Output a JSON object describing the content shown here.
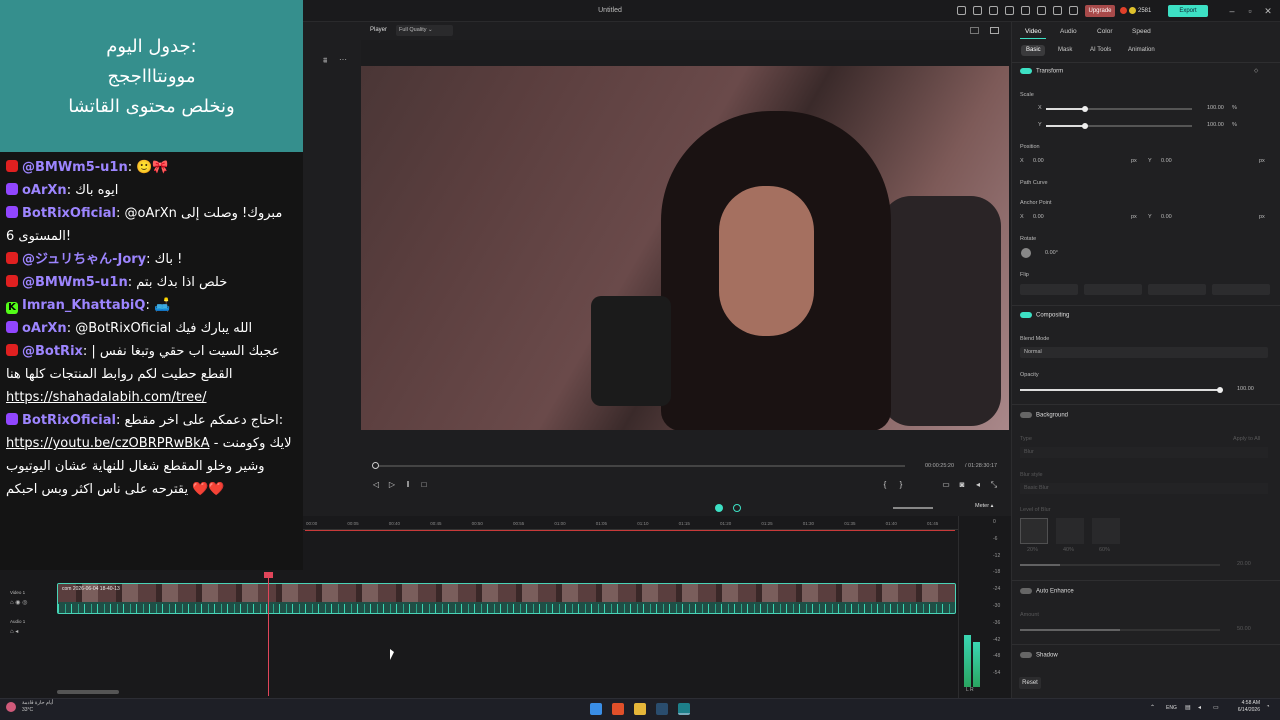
{
  "app": {
    "title": "Untitled",
    "upgrade_label": "Upgrade",
    "credits": "2581",
    "export_label": "Export"
  },
  "overlay": {
    "banner_lines": [
      ":جدول اليوم",
      "موونتاااججج",
      "ونخلص محتوى القاتشا"
    ],
    "chat": [
      {
        "platform": "youtube",
        "user": "@BMWm5-u1n",
        "text": ": 🙂🎀"
      },
      {
        "platform": "twitch",
        "user": "oArXn",
        "text": ": ايوه باك"
      },
      {
        "platform": "twitch",
        "user": "BotRixOficial",
        "text": ": @oArXn مبروك! وصلت إلى المستوى 6!"
      },
      {
        "platform": "youtube",
        "user": "@ジュリちゃん-Jory",
        "text": ": باك !"
      },
      {
        "platform": "youtube",
        "user": "@BMWm5-u1n",
        "text": ": خلص اذا بدك بتم"
      },
      {
        "platform": "kick",
        "user": "Imran_KhattabiQ",
        "text": ": 🛋️"
      },
      {
        "platform": "twitch",
        "user": "oArXn",
        "text": ": @BotRixOficial الله يبارك فيك"
      },
      {
        "platform": "youtube",
        "user": "@BotRix",
        "text": ": عجبك السيت اب حقي وتبغا نفس | القطع حطيت لكم روابط المنتجات كلها هنا",
        "link": "https://shahadalabih.com/tree/"
      },
      {
        "platform": "twitch",
        "user": "BotRixOficial",
        "text": ": احتاج دعمكم على اخر مقطع:",
        "link": "https://youtu.be/czOBRPRwBkA",
        "text2": " - لايك وكومنت وشير وخلو المقطع شغال للنهاية عشان اليوتيوب يقترحه على ناس اكثر وبس احبكم ❤️❤️"
      }
    ]
  },
  "player": {
    "label": "Player",
    "quality": "Full Quality",
    "current_time": "00:00:25:20",
    "total_time": "/ 01:28:30:17"
  },
  "panel": {
    "tabs": [
      "Video",
      "Audio",
      "Color",
      "Speed"
    ],
    "subtabs": [
      "Basic",
      "Mask",
      "AI Tools",
      "Animation"
    ],
    "transform": "Transform",
    "scale": "Scale",
    "scale_x": "100.00",
    "scale_y": "100.00",
    "pct": "%",
    "position": "Position",
    "pos_x": "0.00",
    "pos_y": "0.00",
    "px": "px",
    "path_curve": "Path Curve",
    "anchor": "Anchor Point",
    "anchor_x": "0.00",
    "anchor_y": "0.00",
    "rotate": "Rotate",
    "rotate_val": "0.00°",
    "flip": "Flip",
    "compositing": "Compositing",
    "blend_mode": "Blend Mode",
    "blend_val": "Normal",
    "opacity": "Opacity",
    "opacity_val": "100.00",
    "background": "Background",
    "bg_type": "Type",
    "bg_type_val": "Blur",
    "apply_all": "Apply to All",
    "blur_style": "Blur style",
    "blur_style_val": "Basic Blur",
    "level_of_blur": "Level of Blur",
    "blur_levels": [
      "20%",
      "40%",
      "60%"
    ],
    "blur_val": "20.00",
    "auto_enhance": "Auto Enhance",
    "amount": "Amount",
    "amount_val": "50.00",
    "shadow": "Shadow",
    "reset": "Reset",
    "x": "X",
    "y": "Y"
  },
  "timeline": {
    "ticks": [
      "00:00",
      "00:05",
      "00:40",
      "00:45",
      "00:50",
      "00:55",
      "01:00",
      "01:05",
      "01:10",
      "01:15",
      "01:20",
      "01:25",
      "01:30",
      "01:35",
      "01:40",
      "01:45"
    ],
    "meter_label": "Meter",
    "meter_ticks": [
      "0",
      "-6",
      "-12",
      "-18",
      "-24",
      "-30",
      "-36",
      "-42",
      "-48",
      "-54"
    ],
    "track_video": "Video 1",
    "track_audio": "Audio 1",
    "clip_label": "com 2026-06-04 18-40-13",
    "lr": "L  R"
  },
  "taskbar": {
    "weather_title": "أيام حارة قادمة",
    "weather_temp": "33°C",
    "lang": "ENG",
    "time": "4:58 AM",
    "date": "6/14/2026"
  },
  "colors": {
    "accent": "#3de0c4",
    "banner": "#358f8d",
    "upgrade": "#a84a4a"
  }
}
